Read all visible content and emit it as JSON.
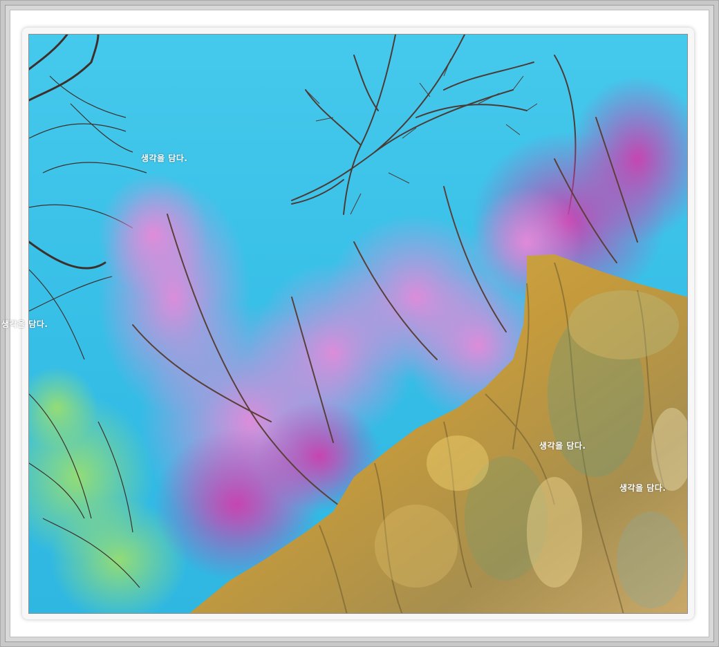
{
  "photo": {
    "subject": "",
    "colors": {
      "sky": "#3cc4e8",
      "sky_light": "#6fd6f0",
      "blossom": "#e07ad6",
      "blossom_deep": "#c93aa8",
      "rock": "#c9a445",
      "rock_dark": "#8d7a3a",
      "rock_green": "#7d9a6a",
      "branch": "#4a3a35",
      "leaf": "#8fd45a"
    }
  },
  "watermarks": {
    "top_left": "생각을 담다.",
    "left_edge": "생각을 담다.",
    "rock_center": "생각을 담다.",
    "rock_right": "생각을 담다."
  }
}
